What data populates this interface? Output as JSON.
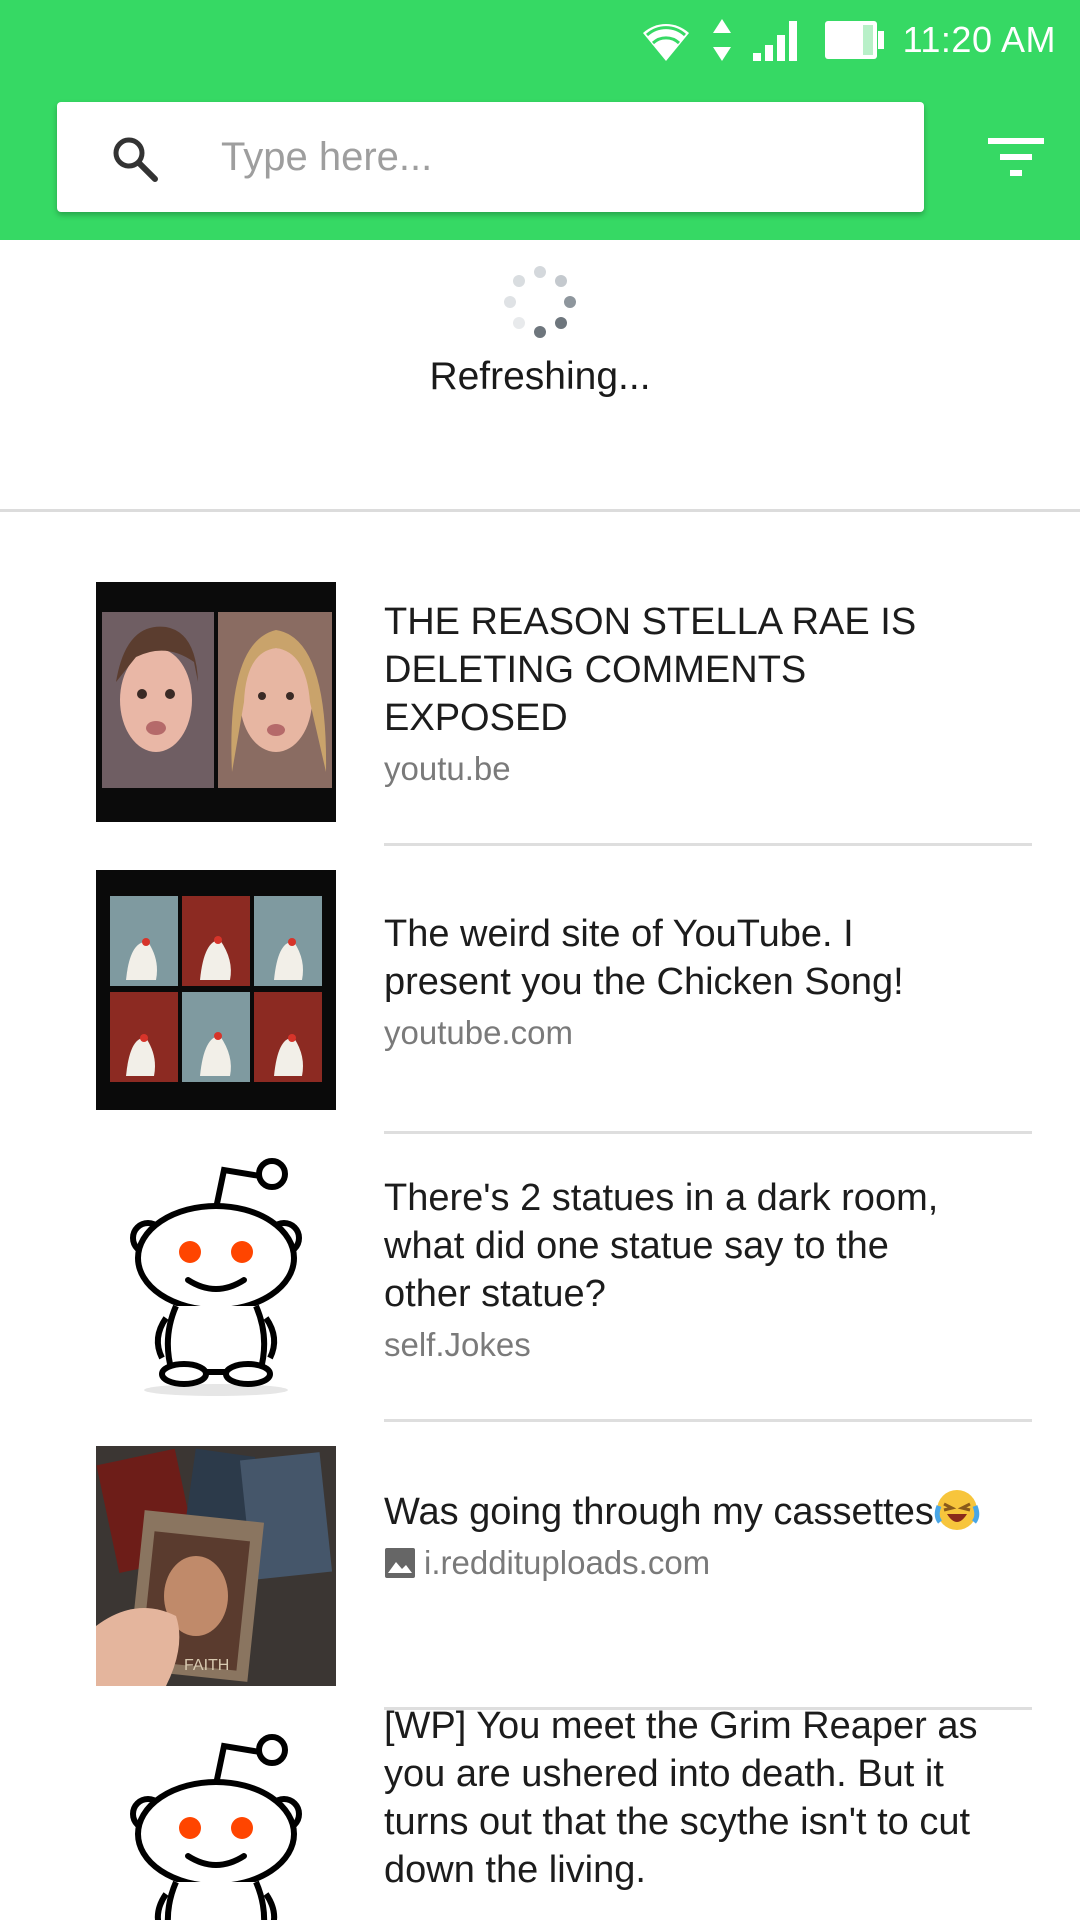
{
  "status_bar": {
    "time": "11:20 AM",
    "icons": [
      "wifi-icon",
      "data-arrows-icon",
      "cell-signal-icon",
      "battery-icon"
    ]
  },
  "search": {
    "placeholder": "Type here...",
    "value": "",
    "search_icon": "search-icon",
    "filter_icon": "filter-icon"
  },
  "refresh": {
    "label": "Refreshing..."
  },
  "colors": {
    "appbar": "#36d964",
    "snoo_eyes": "#ff4500"
  },
  "posts": [
    {
      "title": "THE REASON STELLA RAE IS DELETING COMMENTS EXPOSED",
      "domain": "youtu.be",
      "thumbnail": "two-faces-photo"
    },
    {
      "title": "The weird site of YouTube. I present you the Chicken Song!",
      "domain": "youtube.com",
      "thumbnail": "chickens-grid-photo"
    },
    {
      "title": "There's 2 statues in a dark room, what did one statue say to the other statue?",
      "domain": "self.Jokes",
      "thumbnail": "reddit-snoo-icon"
    },
    {
      "title": "Was going through my cassettes",
      "title_emoji": "laughing-crying-emoji",
      "domain": "i.reddituploads.com",
      "domain_icon": "image-icon",
      "thumbnail": "cassettes-photo"
    },
    {
      "title": "[WP] You meet the Grim Reaper as you are ushered into death. But it turns out that the scythe isn't to cut down the living.",
      "domain": "",
      "thumbnail": "reddit-snoo-icon"
    }
  ]
}
